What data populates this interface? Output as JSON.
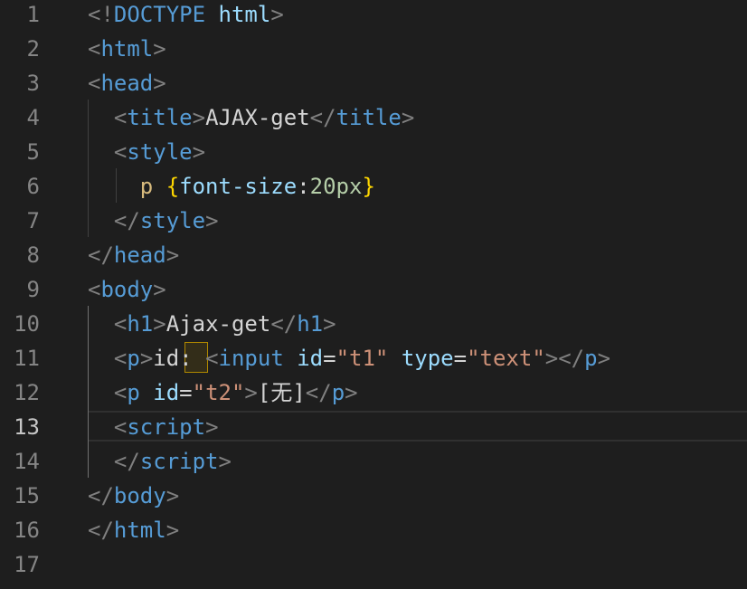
{
  "editor": {
    "active_line": 13,
    "colors": {
      "background": "#1e1e1e",
      "tag": "#569cd6",
      "attribute": "#9cdcfe",
      "string": "#ce9178",
      "bracket": "#808080",
      "selector": "#d7ba7d",
      "number": "#b5cea8"
    },
    "lines": [
      {
        "n": "1",
        "tokens": [
          [
            "<!",
            "bracket"
          ],
          [
            "DOCTYPE",
            "tag"
          ],
          [
            " ",
            "text"
          ],
          [
            "html",
            "attr"
          ],
          [
            ">",
            "bracket"
          ]
        ]
      },
      {
        "n": "2",
        "tokens": [
          [
            "<",
            "bracket"
          ],
          [
            "html",
            "tag"
          ],
          [
            ">",
            "bracket"
          ]
        ]
      },
      {
        "n": "3",
        "tokens": [
          [
            "<",
            "bracket"
          ],
          [
            "head",
            "tag"
          ],
          [
            ">",
            "bracket"
          ]
        ]
      },
      {
        "n": "4",
        "tokens": [
          [
            "  ",
            "text"
          ],
          [
            "<",
            "bracket"
          ],
          [
            "title",
            "tag"
          ],
          [
            ">",
            "bracket"
          ],
          [
            "AJAX-get",
            "text"
          ],
          [
            "</",
            "bracket"
          ],
          [
            "title",
            "tag"
          ],
          [
            ">",
            "bracket"
          ]
        ]
      },
      {
        "n": "5",
        "tokens": [
          [
            "  ",
            "text"
          ],
          [
            "<",
            "bracket"
          ],
          [
            "style",
            "tag"
          ],
          [
            ">",
            "bracket"
          ]
        ]
      },
      {
        "n": "6",
        "tokens": [
          [
            "    ",
            "text"
          ],
          [
            "p",
            "sel"
          ],
          [
            " ",
            "text"
          ],
          [
            "{",
            "brace"
          ],
          [
            "font-size",
            "attr"
          ],
          [
            ":",
            "text"
          ],
          [
            "20px",
            "num"
          ],
          [
            "}",
            "brace"
          ]
        ]
      },
      {
        "n": "7",
        "tokens": [
          [
            "  ",
            "text"
          ],
          [
            "</",
            "bracket"
          ],
          [
            "style",
            "tag"
          ],
          [
            ">",
            "bracket"
          ]
        ]
      },
      {
        "n": "8",
        "tokens": [
          [
            "</",
            "bracket"
          ],
          [
            "head",
            "tag"
          ],
          [
            ">",
            "bracket"
          ]
        ]
      },
      {
        "n": "9",
        "tokens": [
          [
            "<",
            "bracket"
          ],
          [
            "body",
            "tag"
          ],
          [
            ">",
            "bracket"
          ]
        ]
      },
      {
        "n": "10",
        "tokens": [
          [
            "  ",
            "text"
          ],
          [
            "<",
            "bracket"
          ],
          [
            "h1",
            "tag"
          ],
          [
            ">",
            "bracket"
          ],
          [
            "Ajax-get",
            "text"
          ],
          [
            "</",
            "bracket"
          ],
          [
            "h1",
            "tag"
          ],
          [
            ">",
            "bracket"
          ]
        ]
      },
      {
        "n": "11",
        "tokens": [
          [
            "  ",
            "text"
          ],
          [
            "<",
            "bracket"
          ],
          [
            "p",
            "tag"
          ],
          [
            ">",
            "bracket"
          ],
          [
            "id: ",
            "text"
          ],
          [
            "<",
            "bracket"
          ],
          [
            "input",
            "tag"
          ],
          [
            " ",
            "text"
          ],
          [
            "id",
            "attr"
          ],
          [
            "=",
            "text"
          ],
          [
            "\"t1\"",
            "str"
          ],
          [
            " ",
            "text"
          ],
          [
            "type",
            "attr"
          ],
          [
            "=",
            "text"
          ],
          [
            "\"text\"",
            "str"
          ],
          [
            ">",
            "bracket"
          ],
          [
            "</",
            "bracket"
          ],
          [
            "p",
            "tag"
          ],
          [
            ">",
            "bracket"
          ]
        ]
      },
      {
        "n": "12",
        "tokens": [
          [
            "  ",
            "text"
          ],
          [
            "<",
            "bracket"
          ],
          [
            "p",
            "tag"
          ],
          [
            " ",
            "text"
          ],
          [
            "id",
            "attr"
          ],
          [
            "=",
            "text"
          ],
          [
            "\"t2\"",
            "str"
          ],
          [
            ">",
            "bracket"
          ],
          [
            "[无]",
            "text"
          ],
          [
            "</",
            "bracket"
          ],
          [
            "p",
            "tag"
          ],
          [
            ">",
            "bracket"
          ]
        ]
      },
      {
        "n": "13",
        "tokens": [
          [
            "  ",
            "text"
          ],
          [
            "<",
            "bracket"
          ],
          [
            "script",
            "tag"
          ],
          [
            ">",
            "bracket"
          ]
        ]
      },
      {
        "n": "14",
        "tokens": [
          [
            "  ",
            "text"
          ],
          [
            "</",
            "bracket"
          ],
          [
            "script",
            "tag"
          ],
          [
            ">",
            "bracket"
          ]
        ]
      },
      {
        "n": "15",
        "tokens": [
          [
            "</",
            "bracket"
          ],
          [
            "body",
            "tag"
          ],
          [
            ">",
            "bracket"
          ]
        ]
      },
      {
        "n": "16",
        "tokens": [
          [
            "</",
            "bracket"
          ],
          [
            "html",
            "tag"
          ],
          [
            ">",
            "bracket"
          ]
        ]
      },
      {
        "n": "17",
        "tokens": []
      }
    ]
  }
}
